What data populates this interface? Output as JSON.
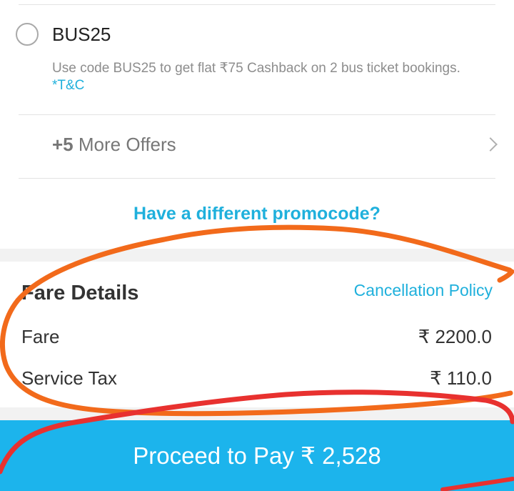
{
  "offer": {
    "code": "BUS25",
    "description": "Use code BUS25 to get flat ₹75 Cashback on 2 bus ticket bookings.",
    "tc_label": "*T&C"
  },
  "more_offers": {
    "count": "+5",
    "label": " More Offers"
  },
  "promo_link": "Have a different promocode?",
  "fare_details": {
    "title": "Fare Details",
    "cancellation_link": "Cancellation Policy",
    "fare_label": "Fare",
    "fare_value": "₹ 2200.0",
    "tax_label": "Service Tax",
    "tax_value": "₹ 110.0"
  },
  "pay_button": "Proceed to Pay ₹ 2,528",
  "colors": {
    "accent": "#1fb0dc",
    "button": "#1cb4ec",
    "annotation_orange": "#f26a1b",
    "annotation_red": "#e8312f"
  }
}
